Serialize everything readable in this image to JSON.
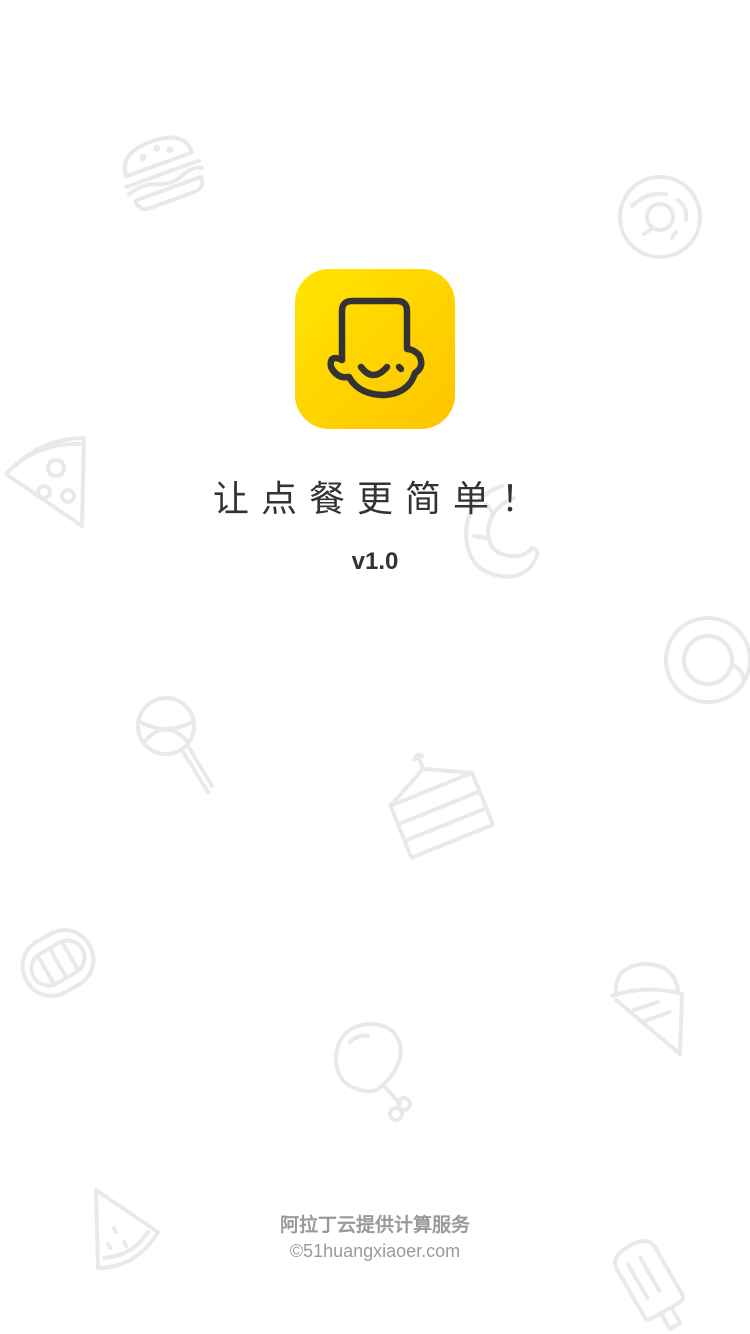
{
  "splash": {
    "slogan": "让点餐更简单！",
    "version": "v1.0",
    "provider": "阿拉丁云提供计算服务",
    "copyright": "©51huangxiaoer.com"
  },
  "colors": {
    "logo_yellow": "#ffd600",
    "logo_stroke": "#333333",
    "background": "#ffffff",
    "pattern": "#e9e9e9",
    "footer_text": "#9a9a9a"
  },
  "icons": {
    "logo": "chef-face-icon",
    "pattern": [
      "burger-icon",
      "donut-icon",
      "pizza-slice-icon",
      "croissant-icon",
      "egg-icon",
      "lollipop-icon",
      "cake-slice-icon",
      "hotdog-icon",
      "ice-cream-cone-icon",
      "chicken-leg-icon",
      "watermelon-slice-icon",
      "popsicle-icon"
    ]
  }
}
